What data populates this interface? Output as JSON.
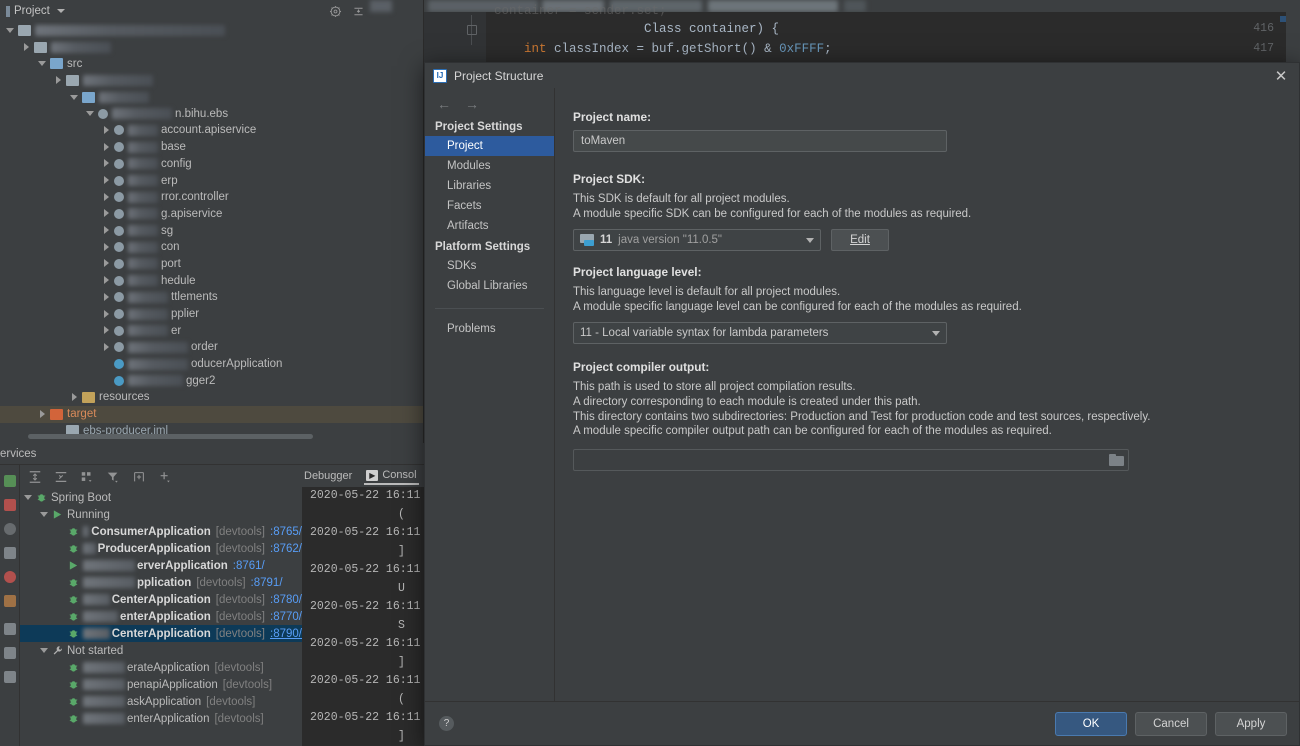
{
  "ide": {
    "project_panel": {
      "tab_label": "Project",
      "icons": [
        "settings-gear-icon",
        "collapse-all-icon"
      ],
      "tree": [
        {
          "id": "root",
          "indent": 0,
          "twist": "open",
          "icon": "folder",
          "label": "",
          "blur": true,
          "blur_w": 190
        },
        {
          "id": "idea",
          "indent": 1,
          "twist": "closed",
          "icon": "folder",
          "label": "",
          "blur": true,
          "blur_w": 60
        },
        {
          "id": "src",
          "indent": 2,
          "twist": "open",
          "icon": "folder-src",
          "label": "src",
          "blur": false
        },
        {
          "id": "main",
          "indent": 3,
          "twist": "closed",
          "icon": "folder",
          "label": "",
          "blur": true,
          "blur_w": 70
        },
        {
          "id": "java",
          "indent": 4,
          "twist": "open",
          "icon": "folder-src",
          "label": "",
          "blur": true,
          "blur_w": 50
        },
        {
          "id": "pkg-root",
          "indent": 5,
          "twist": "open",
          "icon": "pkg",
          "label": "n.bihu.ebs",
          "blur": true,
          "blur_w": 60
        },
        {
          "id": "account",
          "indent": 6,
          "twist": "closed",
          "icon": "pkg",
          "label": "account.apiservice",
          "blur": true,
          "blur_w": 30
        },
        {
          "id": "base",
          "indent": 6,
          "twist": "closed",
          "icon": "pkg",
          "label": "base",
          "blur": true,
          "blur_w": 30
        },
        {
          "id": "config",
          "indent": 6,
          "twist": "closed",
          "icon": "pkg",
          "label": "config",
          "blur": true,
          "blur_w": 30
        },
        {
          "id": "erp",
          "indent": 6,
          "twist": "closed",
          "icon": "pkg",
          "label": "erp",
          "blur": true,
          "blur_w": 30
        },
        {
          "id": "errorctl",
          "indent": 6,
          "twist": "closed",
          "icon": "pkg",
          "label": "rror.controller",
          "blur": true,
          "blur_w": 30
        },
        {
          "id": "gapi",
          "indent": 6,
          "twist": "closed",
          "icon": "pkg",
          "label": "g.apiservice",
          "blur": true,
          "blur_w": 30
        },
        {
          "id": "msg",
          "indent": 6,
          "twist": "closed",
          "icon": "pkg",
          "label": "sg",
          "blur": true,
          "blur_w": 30
        },
        {
          "id": "con",
          "indent": 6,
          "twist": "closed",
          "icon": "pkg",
          "label": "con",
          "blur": true,
          "blur_w": 30
        },
        {
          "id": "port",
          "indent": 6,
          "twist": "closed",
          "icon": "pkg",
          "label": "port",
          "blur": true,
          "blur_w": 30
        },
        {
          "id": "schedule",
          "indent": 6,
          "twist": "closed",
          "icon": "pkg",
          "label": "hedule",
          "blur": true,
          "blur_w": 30
        },
        {
          "id": "settlements",
          "indent": 6,
          "twist": "closed",
          "icon": "pkg",
          "label": "ttlements",
          "blur": true,
          "blur_w": 40
        },
        {
          "id": "supplier",
          "indent": 6,
          "twist": "closed",
          "icon": "pkg",
          "label": "pplier",
          "blur": true,
          "blur_w": 40
        },
        {
          "id": "er",
          "indent": 6,
          "twist": "closed",
          "icon": "pkg",
          "label": "er",
          "blur": true,
          "blur_w": 40
        },
        {
          "id": "order",
          "indent": 6,
          "twist": "closed",
          "icon": "pkg",
          "label": "order",
          "blur": true,
          "blur_w": 60
        },
        {
          "id": "producerapp",
          "indent": 6,
          "twist": "none",
          "icon": "class",
          "label": "oducerApplication",
          "blur": true,
          "blur_w": 60
        },
        {
          "id": "logger2",
          "indent": 6,
          "twist": "none",
          "icon": "class",
          "label": "gger2",
          "blur": true,
          "blur_w": 55
        },
        {
          "id": "resources",
          "indent": 4,
          "twist": "closed",
          "icon": "folder-res",
          "label": "resources",
          "blur": false
        },
        {
          "id": "target",
          "indent": 2,
          "twist": "closed",
          "icon": "folder-target",
          "label": "target",
          "blur": false,
          "style": "target",
          "selected": true
        },
        {
          "id": "iml",
          "indent": 3,
          "twist": "none",
          "icon": "iml",
          "label": "ebs-producer.iml",
          "blur": false,
          "style": "iml"
        }
      ]
    },
    "editor": {
      "lines": [
        {
          "no": "416",
          "code": "                    Class<?> container) {",
          "fold": true
        },
        {
          "no": "417",
          "code": "    int classIndex = buf.getShort() & 0xFFFF;",
          "fold": false
        }
      ],
      "partial_line_above": "container = sender.set;"
    },
    "services": {
      "title": "ervices",
      "toolbar_icons": [
        "expand-all-icon",
        "collapse-all-icon",
        "group-by-icon",
        "filter-icon",
        "add-tab-icon",
        "add-icon"
      ],
      "tree": [
        {
          "indent": 0,
          "twist": "open",
          "icon": "spring-boot",
          "name": "Spring Boot",
          "bold": false,
          "dev": "",
          "port": "",
          "blur": 0
        },
        {
          "indent": 1,
          "twist": "open",
          "icon": "run",
          "name": "Running",
          "bold": false,
          "dev": "",
          "port": "",
          "blur": 0
        },
        {
          "indent": 2,
          "twist": "none",
          "icon": "bug",
          "name": "ConsumerApplication",
          "bold": true,
          "dev": "[devtools]",
          "port": ":8765/",
          "blur": 52
        },
        {
          "indent": 2,
          "twist": "none",
          "icon": "bug",
          "name": "ProducerApplication",
          "bold": true,
          "dev": "[devtools]",
          "port": ":8762/",
          "blur": 52
        },
        {
          "indent": 2,
          "twist": "none",
          "icon": "run",
          "name": "erverApplication",
          "bold": true,
          "dev": "",
          "port": ":8761/",
          "blur": 52
        },
        {
          "indent": 2,
          "twist": "none",
          "icon": "bug",
          "name": "pplication",
          "bold": true,
          "dev": "[devtools]",
          "port": ":8791/",
          "blur": 52
        },
        {
          "indent": 2,
          "twist": "none",
          "icon": "bug",
          "name": "CenterApplication",
          "bold": true,
          "dev": "[devtools]",
          "port": ":8780/",
          "blur": 52
        },
        {
          "indent": 2,
          "twist": "none",
          "icon": "bug",
          "name": "enterApplication",
          "bold": true,
          "dev": "[devtools]",
          "port": ":8770/",
          "blur": 52
        },
        {
          "indent": 2,
          "twist": "none",
          "icon": "bug",
          "name": "CenterApplication",
          "bold": true,
          "dev": "[devtools]",
          "port": ":8790/",
          "blur": 52,
          "selected": true,
          "port_underline": true
        },
        {
          "indent": 1,
          "twist": "open",
          "icon": "wrench",
          "name": "Not started",
          "bold": false,
          "dev": "",
          "port": "",
          "blur": 0
        },
        {
          "indent": 2,
          "twist": "none",
          "icon": "spring",
          "name": "erateApplication",
          "bold": false,
          "dev": "[devtools]",
          "port": "",
          "blur": 42
        },
        {
          "indent": 2,
          "twist": "none",
          "icon": "spring",
          "name": "penapiApplication",
          "bold": false,
          "dev": "[devtools]",
          "port": "",
          "blur": 42
        },
        {
          "indent": 2,
          "twist": "none",
          "icon": "spring",
          "name": "askApplication",
          "bold": false,
          "dev": "[devtools]",
          "port": "",
          "blur": 42
        },
        {
          "indent": 2,
          "twist": "none",
          "icon": "spring",
          "name": "enterApplication",
          "bold": false,
          "dev": "[devtools]",
          "port": "",
          "blur": 42
        }
      ],
      "console_tabs": [
        {
          "label": "Debugger",
          "active": false,
          "icon": ""
        },
        {
          "label": "Consol",
          "active": true,
          "icon": "run-icon"
        }
      ],
      "console_lines": [
        "2020-05-22 16:11",
        "(",
        "2020-05-22 16:11",
        "]",
        "2020-05-22 16:11",
        "U",
        "2020-05-22 16:11",
        "S",
        "2020-05-22 16:11",
        "]",
        "2020-05-22 16:11",
        "(",
        "2020-05-22 16:11",
        "]"
      ]
    }
  },
  "dialog": {
    "title": "Project Structure",
    "logo": "intellij-idea-icon",
    "close_label": "✕",
    "nav": {
      "back": "←",
      "forward": "→"
    },
    "sidebar": [
      {
        "type": "group",
        "label": "Project Settings"
      },
      {
        "type": "item",
        "label": "Project",
        "active": true
      },
      {
        "type": "item",
        "label": "Modules",
        "active": false
      },
      {
        "type": "item",
        "label": "Libraries",
        "active": false
      },
      {
        "type": "item",
        "label": "Facets",
        "active": false
      },
      {
        "type": "item",
        "label": "Artifacts",
        "active": false
      },
      {
        "type": "group",
        "label": "Platform Settings"
      },
      {
        "type": "item",
        "label": "SDKs",
        "active": false
      },
      {
        "type": "item",
        "label": "Global Libraries",
        "active": false
      },
      {
        "type": "separator"
      },
      {
        "type": "item",
        "label": "Problems",
        "active": false
      }
    ],
    "main": {
      "project_name_label": "Project name:",
      "project_name_value": "toMaven",
      "sdk_label": "Project SDK:",
      "sdk_desc_1": "This SDK is default for all project modules.",
      "sdk_desc_2": "A module specific SDK can be configured for each of the modules as required.",
      "sdk_version": "11",
      "sdk_name": "java version \"11.0.5\"",
      "sdk_edit_button": "Edit",
      "lang_label": "Project language level:",
      "lang_desc_1": "This language level is default for all project modules.",
      "lang_desc_2": "A module specific language level can be configured for each of the modules as required.",
      "lang_value": "11 - Local variable syntax for lambda parameters",
      "out_label": "Project compiler output:",
      "out_desc_1": "This path is used to store all project compilation results.",
      "out_desc_2": "A directory corresponding to each module is created under this path.",
      "out_desc_3": "This directory contains two subdirectories: Production and Test for production code and test sources, respectively.",
      "out_desc_4": "A module specific compiler output path can be configured for each of the modules as required.",
      "out_value": "",
      "out_browse_icon": "folder-icon"
    },
    "footer": {
      "help_label": "?",
      "ok_label": "OK",
      "cancel_label": "Cancel",
      "apply_label": "Apply"
    }
  },
  "colors": {
    "bg": "#3c3f41",
    "editor_bg": "#2b2b2b",
    "accent_blue": "#2d5b9e",
    "selection_blue": "#0d3a58",
    "link_blue": "#589df6",
    "target_orange": "#d98a5a",
    "primary_button": "#365880"
  }
}
